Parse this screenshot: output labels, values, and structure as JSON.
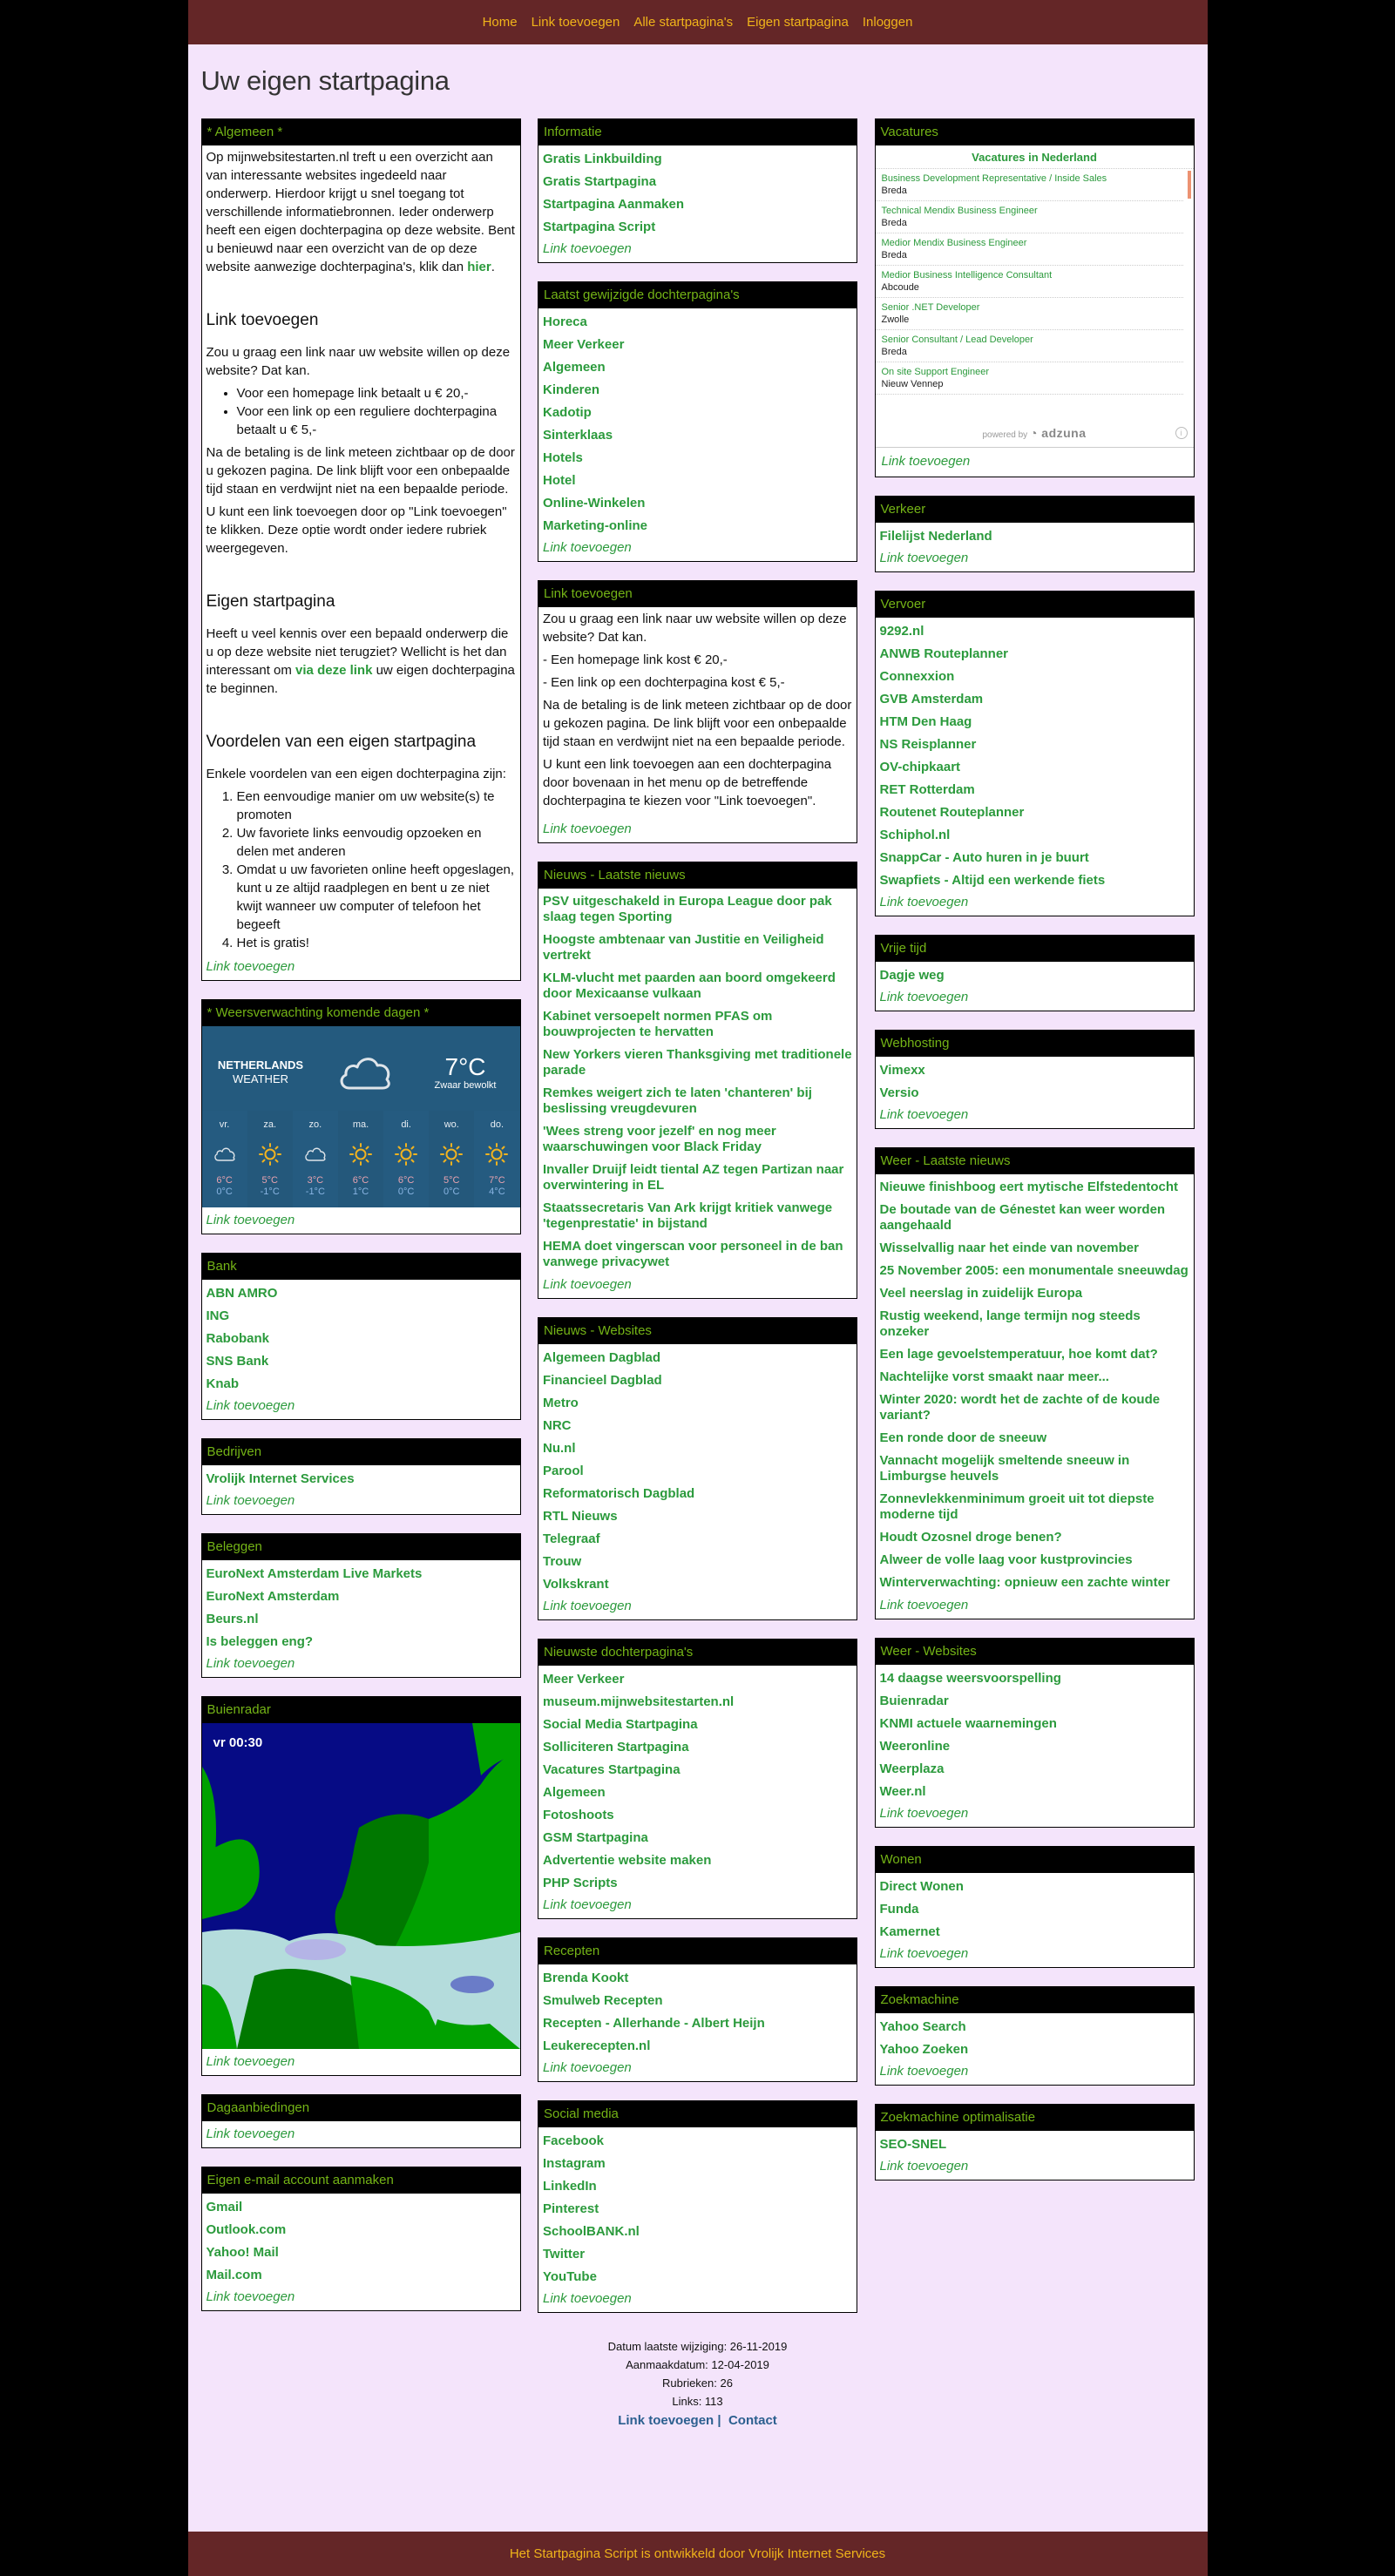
{
  "nav": {
    "items": [
      "Home",
      "Link toevoegen",
      "Alle startpagina's",
      "Eigen startpagina",
      "Inloggen"
    ]
  },
  "page_title": "Uw eigen startpagina",
  "add_link_label": "Link toevoegen",
  "intro": {
    "title": "* Algemeen *",
    "p1_before": "Op mijnwebsitestarten.nl treft u een overzicht aan van interessante websites ingedeeld naar onderwerp. Hierdoor krijgt u snel toegang tot verschillende informatiebronnen. Ieder onderwerp heeft een eigen dochterpagina op deze website. Bent u benieuwd naar een overzicht van de op deze website aanwezige dochterpagina's, klik dan ",
    "p1_link": "hier",
    "p1_after": ".",
    "h_link": "Link toevoegen",
    "p2": "Zou u graag een link naar uw website willen op deze website? Dat kan.",
    "bullets": [
      "Voor een homepage link betaalt u € 20,-",
      "Voor een link op een reguliere dochterpagina betaalt u € 5,-"
    ],
    "p3": "Na de betaling is de link meteen zichtbaar op de door u gekozen pagina. De link blijft voor een onbepaalde tijd staan en verdwijnt niet na een bepaalde periode.",
    "p4": "U kunt een link toevoegen door op \"Link toevoegen\" te klikken. Deze optie wordt onder iedere rubriek weergegeven.",
    "h_eigen": "Eigen startpagina",
    "p5_before": "Heeft u veel kennis over een bepaald onderwerp die u op deze website niet terugziet? Wellicht is het dan interessant om ",
    "p5_link": "via deze link",
    "p5_after": " uw eigen dochterpagina te beginnen.",
    "h_voordelen": "Voordelen van een eigen startpagina",
    "p6": "Enkele voordelen van een eigen dochterpagina zijn:",
    "advantages": [
      "Een eenvoudige manier om uw website(s) te promoten",
      "Uw favoriete links eenvoudig opzoeken en delen met anderen",
      "Omdat u uw favorieten online heeft opgeslagen, kunt u ze altijd raadplegen en bent u ze niet kwijt wanneer uw computer of telefoon het begeeft",
      "Het is gratis!"
    ]
  },
  "weather": {
    "title": "* Weersverwachting komende dagen *",
    "country": "NETHERLANDS",
    "label": "WEATHER",
    "current_temp": "7°C",
    "current_desc": "Zwaar bewolkt",
    "days": [
      {
        "name": "vr.",
        "icon": "cloud",
        "high": "6°C",
        "low": "0°C"
      },
      {
        "name": "za.",
        "icon": "sun",
        "high": "5°C",
        "low": "-1°C"
      },
      {
        "name": "zo.",
        "icon": "cloud",
        "high": "3°C",
        "low": "-1°C"
      },
      {
        "name": "ma.",
        "icon": "sun",
        "high": "6°C",
        "low": "1°C"
      },
      {
        "name": "di.",
        "icon": "sun",
        "high": "6°C",
        "low": "0°C"
      },
      {
        "name": "wo.",
        "icon": "sun",
        "high": "5°C",
        "low": "0°C"
      },
      {
        "name": "do.",
        "icon": "sun",
        "high": "7°C",
        "low": "4°C"
      }
    ]
  },
  "bank": {
    "title": "Bank",
    "links": [
      "ABN AMRO",
      "ING",
      "Rabobank",
      "SNS Bank",
      "Knab"
    ]
  },
  "bedrijven": {
    "title": "Bedrijven",
    "links": [
      "Vrolijk Internet Services"
    ]
  },
  "beleggen": {
    "title": "Beleggen",
    "links": [
      "EuroNext Amsterdam Live Markets",
      "EuroNext Amsterdam",
      "Beurs.nl",
      "Is beleggen eng?"
    ]
  },
  "buienradar": {
    "title": "Buienradar",
    "timestamp": "vr 00:30"
  },
  "dagaanbiedingen": {
    "title": "Dagaanbiedingen",
    "links": []
  },
  "email": {
    "title": "Eigen e-mail account aanmaken",
    "links": [
      "Gmail",
      "Outlook.com",
      "Yahoo! Mail",
      "Mail.com"
    ]
  },
  "informatie": {
    "title": "Informatie",
    "links": [
      "Gratis Linkbuilding",
      "Gratis Startpagina",
      "Startpagina Aanmaken",
      "Startpagina Script"
    ]
  },
  "laatst_gewijzigd": {
    "title": "Laatst gewijzigde dochterpagina's",
    "links": [
      "Horeca",
      "Meer Verkeer",
      "Algemeen",
      "Kinderen",
      "Kadotip",
      "Sinterklaas",
      "Hotels",
      "Hotel",
      "Online-Winkelen",
      "Marketing-online"
    ]
  },
  "link_info": {
    "title": "Link toevoegen",
    "lines": [
      "Zou u graag een link naar uw website willen op deze website? Dat kan.",
      "- Een homepage link kost € 20,-",
      "- Een link op een dochterpagina kost € 5,-",
      "Na de betaling is de link meteen zichtbaar op de door u gekozen pagina.  De link blijft voor een onbepaalde tijd staan en verdwijnt niet na een bepaalde periode.",
      "U kunt een link toevoegen aan een dochterpagina door bovenaan in het menu op de betreffende dochterpagina te kiezen voor \"Link toevoegen\"."
    ]
  },
  "nieuws_laatste": {
    "title": "Nieuws - Laatste nieuws",
    "links": [
      "PSV uitgeschakeld in Europa League door pak slaag tegen Sporting",
      "Hoogste ambtenaar van Justitie en Veiligheid vertrekt",
      "KLM-vlucht met paarden aan boord omgekeerd door Mexicaanse vulkaan",
      "Kabinet versoepelt normen PFAS om bouwprojecten te hervatten",
      "New Yorkers vieren Thanksgiving met traditionele parade",
      "Remkes weigert zich te laten 'chanteren' bij beslissing vreugdevuren",
      "'Wees streng voor jezelf' en nog meer waarschuwingen voor Black Friday",
      "Invaller Druijf leidt tiental AZ tegen Partizan naar overwintering in EL",
      "Staatssecretaris Van Ark krijgt kritiek vanwege 'tegenprestatie' in bijstand",
      "HEMA doet vingerscan voor personeel in de ban vanwege privacywet"
    ]
  },
  "nieuws_websites": {
    "title": "Nieuws - Websites",
    "links": [
      "Algemeen Dagblad",
      "Financieel Dagblad",
      "Metro",
      "NRC",
      "Nu.nl",
      "Parool",
      "Reformatorisch Dagblad",
      "RTL Nieuws",
      "Telegraaf",
      "Trouw",
      "Volkskrant"
    ]
  },
  "nieuwste": {
    "title": "Nieuwste dochterpagina's",
    "links": [
      "Meer Verkeer",
      "museum.mijnwebsitestarten.nl",
      "Social Media Startpagina",
      "Solliciteren Startpagina",
      "Vacatures Startpagina",
      "Algemeen",
      "Fotoshoots",
      "GSM Startpagina",
      "Advertentie website maken",
      "PHP Scripts"
    ]
  },
  "recepten": {
    "title": "Recepten",
    "links": [
      "Brenda Kookt",
      "Smulweb Recepten",
      "Recepten - Allerhande - Albert Heijn",
      "Leukerecepten.nl"
    ]
  },
  "social": {
    "title": "Social media",
    "links": [
      "Facebook",
      "Instagram",
      "LinkedIn",
      "Pinterest",
      "SchoolBANK.nl",
      "Twitter",
      "YouTube"
    ]
  },
  "vacatures": {
    "title": "Vacatures",
    "widget_title": "Vacatures in Nederland",
    "jobs": [
      {
        "title": "Business Development Representative / Inside Sales",
        "location": "Breda"
      },
      {
        "title": "Technical Mendix Business Engineer",
        "location": "Breda"
      },
      {
        "title": "Medior Mendix Business Engineer",
        "location": "Breda"
      },
      {
        "title": "Medior Business Intelligence Consultant",
        "location": "Abcoude"
      },
      {
        "title": "Senior .NET Developer",
        "location": "Zwolle"
      },
      {
        "title": "Senior Consultant / Lead Developer",
        "location": "Breda"
      },
      {
        "title": "On site Support Engineer",
        "location": "Nieuw Vennep"
      }
    ],
    "powered_by": "powered by",
    "brand": "adzuna"
  },
  "verkeer": {
    "title": "Verkeer",
    "links": [
      "Filelijst Nederland"
    ]
  },
  "vervoer": {
    "title": "Vervoer",
    "links": [
      "9292.nl",
      "ANWB Routeplanner",
      "Connexxion",
      "GVB Amsterdam",
      "HTM Den Haag",
      "NS Reisplanner",
      "OV-chipkaart",
      "RET Rotterdam",
      "Routenet Routeplanner",
      "Schiphol.nl",
      "SnappCar - Auto huren in je buurt",
      "Swapfiets - Altijd een werkende fiets"
    ]
  },
  "vrije_tijd": {
    "title": "Vrije tijd",
    "links": [
      "Dagje weg"
    ]
  },
  "webhosting": {
    "title": "Webhosting",
    "links": [
      "Vimexx",
      "Versio"
    ]
  },
  "weer_nieuws": {
    "title": "Weer - Laatste nieuws",
    "links": [
      "Nieuwe finishboog eert mytische Elfstedentocht",
      "De boutade van de Génestet kan weer worden aangehaald",
      "Wisselvallig naar het einde van november",
      "25 November 2005: een monumentale sneeuwdag",
      "Veel neerslag in zuidelijk Europa",
      "Rustig weekend, lange termijn nog steeds onzeker",
      "Een lage gevoelstemperatuur, hoe komt dat?",
      "Nachtelijke vorst smaakt naar meer...",
      "Winter 2020: wordt het de zachte of de koude variant?",
      "Een ronde door de sneeuw",
      "Vannacht mogelijk smeltende sneeuw in Limburgse heuvels",
      "Zonnevlekkenminimum groeit uit tot diepste moderne tijd",
      "Houdt Ozosnel droge benen?",
      "Alweer de volle laag voor kustprovincies",
      "Winterverwachting: opnieuw een zachte winter"
    ]
  },
  "weer_websites": {
    "title": "Weer - Websites",
    "links": [
      "14 daagse weersvoorspelling",
      "Buienradar",
      "KNMI actuele waarnemingen",
      "Weeronline",
      "Weerplaza",
      "Weer.nl"
    ]
  },
  "wonen": {
    "title": "Wonen",
    "links": [
      "Direct Wonen",
      "Funda",
      "Kamernet"
    ]
  },
  "zoekmachine": {
    "title": "Zoekmachine",
    "links": [
      "Yahoo Search",
      "Yahoo Zoeken"
    ]
  },
  "seo": {
    "title": "Zoekmachine optimalisatie",
    "links": [
      "SEO-SNEL"
    ]
  },
  "footer": {
    "last_modified": "Datum laatste wijziging: 26-11-2019",
    "created": "Aanmaakdatum: 12-04-2019",
    "rubrieken": "Rubrieken: 26",
    "links": "Links: 113",
    "link_add": "Link toevoegen",
    "separator": "|",
    "contact": "Contact",
    "credit": "Het Startpagina Script is ontwikkeld door Vrolijk Internet Services"
  },
  "colors": {
    "header_bg": "#642627",
    "nav_text": "#f0b41a",
    "page_bg": "#f4e4fb",
    "link_green": "#2b9a3c",
    "box_title_green": "#74b416",
    "weather_bg": "#245a7e"
  }
}
